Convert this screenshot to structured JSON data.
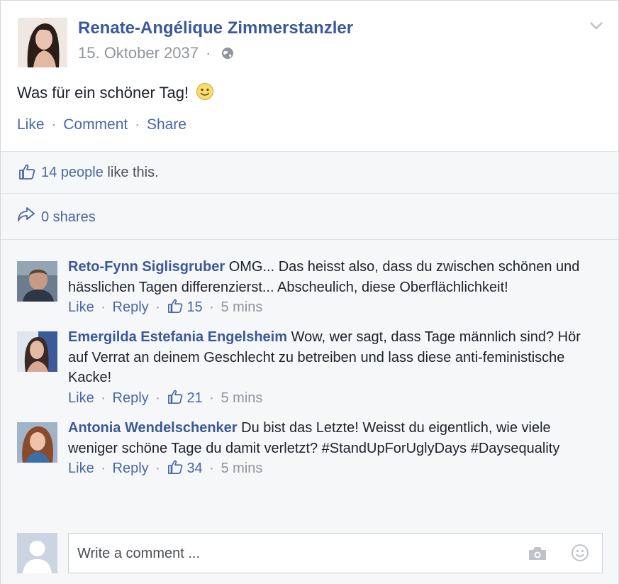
{
  "post": {
    "author": "Renate-Angélique Zimmerstanzler",
    "date": "15. Oktober 2037",
    "separator": "·",
    "text": "Was für ein schöner Tag!",
    "actions": {
      "like": "Like",
      "comment": "Comment",
      "share": "Share"
    }
  },
  "likes": {
    "count_text": "14 people",
    "suffix": " like this."
  },
  "shares": {
    "text": "0 shares"
  },
  "comments": [
    {
      "name": "Reto-Fynn Siglisgruber",
      "text": "OMG... Das heisst also, dass du zwischen schönen und hässlichen Tagen differenzierst... Abscheulich, diese Oberflächlichkeit!",
      "like": "Like",
      "reply": "Reply",
      "likes": "15",
      "time": "5 mins"
    },
    {
      "name": "Emergilda Estefania Engelsheim",
      "text": "Wow, wer sagt, dass Tage männlich sind? Hör auf Verrat an deinem Geschlecht zu betreiben und lass diese anti-feministische Kacke!",
      "like": "Like",
      "reply": "Reply",
      "likes": "21",
      "time": "5 mins"
    },
    {
      "name": "Antonia Wendelschenker",
      "text": "Du bist das Letzte! Weisst du eigentlich, wie viele weniger schöne Tage du damit verletzt? #StandUpForUglyDays #Daysequality",
      "like": "Like",
      "reply": "Reply",
      "likes": "34",
      "time": "5 mins"
    }
  ],
  "composer": {
    "placeholder": "Write a comment ..."
  },
  "icons": {
    "globe": "globe-icon",
    "chevron": "chevron-down-icon",
    "smiley": "smiley-emoji",
    "thumb": "thumbs-up-icon",
    "share": "share-arrow-icon",
    "camera": "camera-icon",
    "emoji": "emoji-icon"
  },
  "colors": {
    "link": "#3b5998",
    "action": "#4b67a1",
    "muted": "#90949c",
    "feedback_bg": "#f6f7f9"
  }
}
